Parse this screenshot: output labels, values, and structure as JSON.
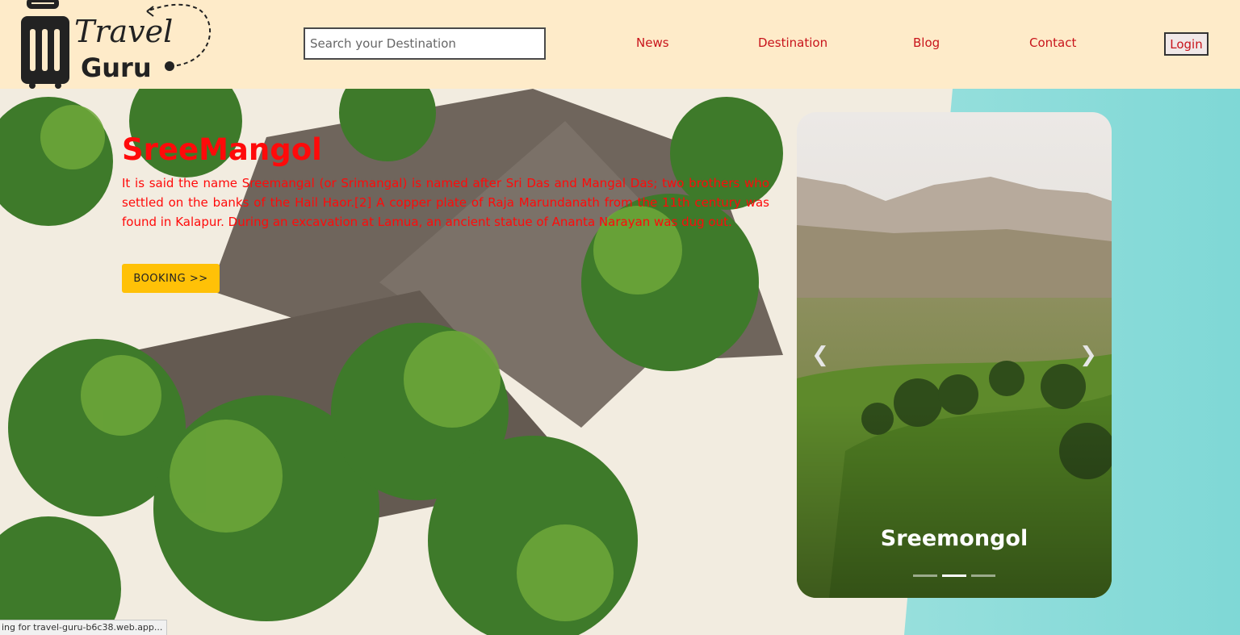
{
  "header": {
    "brand_line1": "Travel",
    "brand_line2": "Guru",
    "search_placeholder": "Search your Destination",
    "nav": [
      "News",
      "Destination",
      "Blog",
      "Contact"
    ],
    "login_label": "Login"
  },
  "hero": {
    "title": "SreeMangol",
    "description": "It is said the name Sreemangal (or Srimangal) is named after Sri Das and Mangal Das; two brothers who settled on the banks of the Hail Haor.[2] A copper plate of Raja Marundanath from the 11th century was found in Kalapur. During an excavation at Lamua, an ancient statue of Ananta Narayan was dug out.",
    "booking_label": "BOOKING >>"
  },
  "carousel": {
    "caption": "Sreemongol",
    "prev_icon": "chevron-left-icon",
    "next_icon": "chevron-right-icon",
    "indicator_count": 3,
    "active_index": 1
  },
  "status_bar": {
    "text": "ing for travel-guru-b6c38.web.app..."
  },
  "colors": {
    "header_bg": "#feebc9",
    "accent_red": "#c8141b",
    "hero_text": "#ff0a0a",
    "booking_bg": "#ffc107"
  }
}
